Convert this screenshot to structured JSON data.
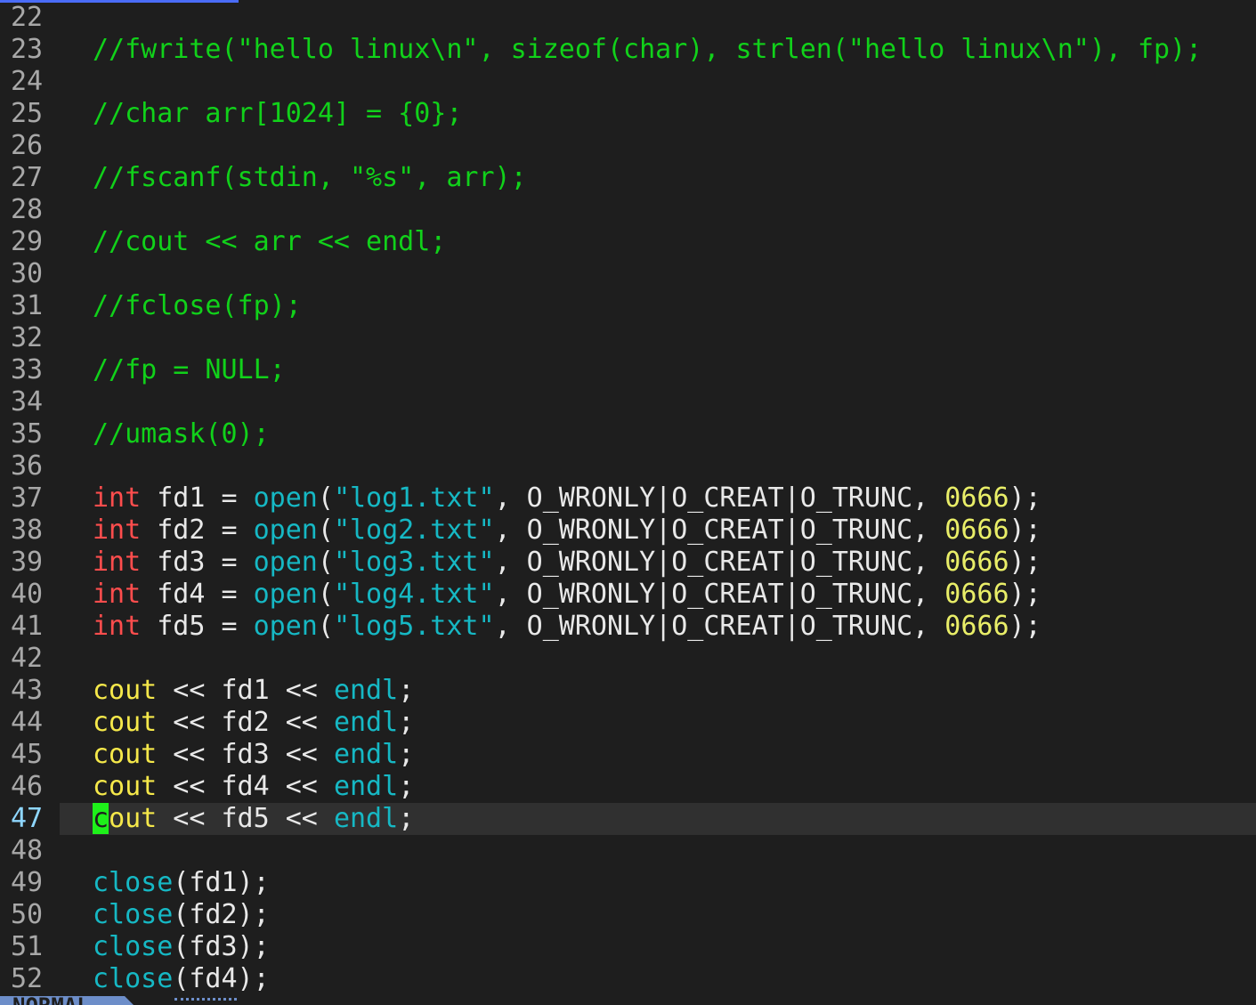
{
  "editor": {
    "lines": [
      {
        "n": "22",
        "tokens": []
      },
      {
        "n": "23",
        "tokens": [
          {
            "c": "comment",
            "t": "//fwrite(\"hello linux\\n\", sizeof(char), strlen(\"hello linux\\n\"), fp);"
          }
        ]
      },
      {
        "n": "24",
        "tokens": []
      },
      {
        "n": "25",
        "tokens": [
          {
            "c": "comment",
            "t": "//char arr[1024] = {0};"
          }
        ]
      },
      {
        "n": "26",
        "tokens": []
      },
      {
        "n": "27",
        "tokens": [
          {
            "c": "comment",
            "t": "//fscanf(stdin, \"%s\", arr);"
          }
        ]
      },
      {
        "n": "28",
        "tokens": []
      },
      {
        "n": "29",
        "tokens": [
          {
            "c": "comment",
            "t": "//cout << arr << endl;"
          }
        ]
      },
      {
        "n": "30",
        "tokens": []
      },
      {
        "n": "31",
        "tokens": [
          {
            "c": "comment",
            "t": "//fclose(fp);"
          }
        ]
      },
      {
        "n": "32",
        "tokens": []
      },
      {
        "n": "33",
        "tokens": [
          {
            "c": "comment",
            "t": "//fp = NULL;"
          }
        ]
      },
      {
        "n": "34",
        "tokens": []
      },
      {
        "n": "35",
        "tokens": [
          {
            "c": "comment",
            "t": "//umask(0);"
          }
        ]
      },
      {
        "n": "36",
        "tokens": []
      },
      {
        "n": "37",
        "tokens": [
          {
            "c": "keyword",
            "t": "int"
          },
          {
            "c": "ident",
            "t": " fd1 = "
          },
          {
            "c": "func",
            "t": "open"
          },
          {
            "c": "op",
            "t": "("
          },
          {
            "c": "string",
            "t": "\"log1.txt\""
          },
          {
            "c": "op",
            "t": ", O_WRONLY|O_CREAT|O_TRUNC, "
          },
          {
            "c": "number",
            "t": "0666"
          },
          {
            "c": "op",
            "t": ");"
          }
        ]
      },
      {
        "n": "38",
        "tokens": [
          {
            "c": "keyword",
            "t": "int"
          },
          {
            "c": "ident",
            "t": " fd2 = "
          },
          {
            "c": "func",
            "t": "open"
          },
          {
            "c": "op",
            "t": "("
          },
          {
            "c": "string",
            "t": "\"log2.txt\""
          },
          {
            "c": "op",
            "t": ", O_WRONLY|O_CREAT|O_TRUNC, "
          },
          {
            "c": "number",
            "t": "0666"
          },
          {
            "c": "op",
            "t": ");"
          }
        ]
      },
      {
        "n": "39",
        "tokens": [
          {
            "c": "keyword",
            "t": "int"
          },
          {
            "c": "ident",
            "t": " fd3 = "
          },
          {
            "c": "func",
            "t": "open"
          },
          {
            "c": "op",
            "t": "("
          },
          {
            "c": "string",
            "t": "\"log3.txt\""
          },
          {
            "c": "op",
            "t": ", O_WRONLY|O_CREAT|O_TRUNC, "
          },
          {
            "c": "number",
            "t": "0666"
          },
          {
            "c": "op",
            "t": ");"
          }
        ]
      },
      {
        "n": "40",
        "tokens": [
          {
            "c": "keyword",
            "t": "int"
          },
          {
            "c": "ident",
            "t": " fd4 = "
          },
          {
            "c": "func",
            "t": "open"
          },
          {
            "c": "op",
            "t": "("
          },
          {
            "c": "string",
            "t": "\"log4.txt\""
          },
          {
            "c": "op",
            "t": ", O_WRONLY|O_CREAT|O_TRUNC, "
          },
          {
            "c": "number",
            "t": "0666"
          },
          {
            "c": "op",
            "t": ");"
          }
        ]
      },
      {
        "n": "41",
        "tokens": [
          {
            "c": "keyword",
            "t": "int"
          },
          {
            "c": "ident",
            "t": " fd5 = "
          },
          {
            "c": "func",
            "t": "open"
          },
          {
            "c": "op",
            "t": "("
          },
          {
            "c": "string",
            "t": "\"log5.txt\""
          },
          {
            "c": "op",
            "t": ", O_WRONLY|O_CREAT|O_TRUNC, "
          },
          {
            "c": "number",
            "t": "0666"
          },
          {
            "c": "op",
            "t": ");"
          }
        ]
      },
      {
        "n": "42",
        "tokens": []
      },
      {
        "n": "43",
        "tokens": [
          {
            "c": "stream",
            "t": "cout"
          },
          {
            "c": "op",
            "t": " << fd1 << "
          },
          {
            "c": "func",
            "t": "endl"
          },
          {
            "c": "op",
            "t": ";"
          }
        ]
      },
      {
        "n": "44",
        "tokens": [
          {
            "c": "stream",
            "t": "cout"
          },
          {
            "c": "op",
            "t": " << fd2 << "
          },
          {
            "c": "func",
            "t": "endl"
          },
          {
            "c": "op",
            "t": ";"
          }
        ]
      },
      {
        "n": "45",
        "tokens": [
          {
            "c": "stream",
            "t": "cout"
          },
          {
            "c": "op",
            "t": " << fd3 << "
          },
          {
            "c": "func",
            "t": "endl"
          },
          {
            "c": "op",
            "t": ";"
          }
        ]
      },
      {
        "n": "46",
        "tokens": [
          {
            "c": "stream",
            "t": "cout"
          },
          {
            "c": "op",
            "t": " << fd4 << "
          },
          {
            "c": "func",
            "t": "endl"
          },
          {
            "c": "op",
            "t": ";"
          }
        ]
      },
      {
        "n": "47",
        "current": true,
        "tokens": [
          {
            "c": "cursor",
            "t": "c"
          },
          {
            "c": "stream",
            "t": "out"
          },
          {
            "c": "op",
            "t": " << fd5 << "
          },
          {
            "c": "func",
            "t": "endl"
          },
          {
            "c": "op",
            "t": ";"
          }
        ]
      },
      {
        "n": "48",
        "tokens": []
      },
      {
        "n": "49",
        "tokens": [
          {
            "c": "func",
            "t": "close"
          },
          {
            "c": "op",
            "t": "(fd1);"
          }
        ]
      },
      {
        "n": "50",
        "tokens": [
          {
            "c": "func",
            "t": "close"
          },
          {
            "c": "op",
            "t": "(fd2);"
          }
        ]
      },
      {
        "n": "51",
        "tokens": [
          {
            "c": "func",
            "t": "close"
          },
          {
            "c": "op",
            "t": "(fd3);"
          }
        ]
      },
      {
        "n": "52",
        "tokens": [
          {
            "c": "func",
            "t": "close"
          },
          {
            "c": "op",
            "t": "(fd4);"
          }
        ]
      }
    ]
  },
  "statusbar": {
    "mode": "NORMAL"
  },
  "colors": {
    "background": "#1e1e1e",
    "comment": "#11d11a",
    "keyword": "#ff4d4d",
    "function": "#16b8c4",
    "number": "#e9ee68",
    "stream": "#f5e84a",
    "cursor": "#1ef11a",
    "cursorline": "#303030",
    "current_line_number": "#8fd7ff",
    "line_number": "#a8a8a8",
    "mode_bg": "#6d8ec9"
  }
}
